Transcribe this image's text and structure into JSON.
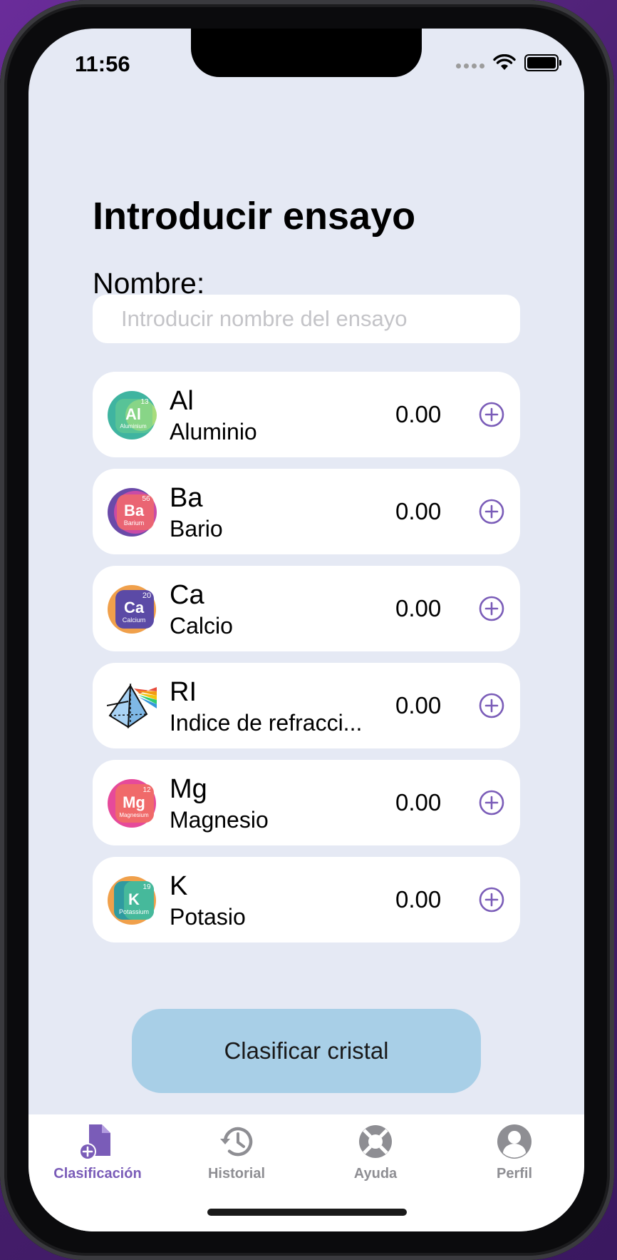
{
  "status_bar": {
    "time": "11:56"
  },
  "page": {
    "title": "Introducir ensayo",
    "name_label": "Nombre:",
    "name_input": {
      "value": "",
      "placeholder": "Introducir nombre del ensayo"
    }
  },
  "elements": [
    {
      "symbol": "Al",
      "name": "Aluminio",
      "value": "0.00",
      "icon": "aluminium-icon",
      "badge": {
        "symbol": "Al",
        "number": "13",
        "label": "Aluminium"
      }
    },
    {
      "symbol": "Ba",
      "name": "Bario",
      "value": "0.00",
      "icon": "barium-icon",
      "badge": {
        "symbol": "Ba",
        "number": "56",
        "label": "Barium"
      }
    },
    {
      "symbol": "Ca",
      "name": "Calcio",
      "value": "0.00",
      "icon": "calcium-icon",
      "badge": {
        "symbol": "Ca",
        "number": "20",
        "label": "Calcium"
      }
    },
    {
      "symbol": "RI",
      "name": "Indice de refracci...",
      "value": "0.00",
      "icon": "prism-icon"
    },
    {
      "symbol": "Mg",
      "name": "Magnesio",
      "value": "0.00",
      "icon": "magnesium-icon",
      "badge": {
        "symbol": "Mg",
        "number": "12",
        "label": "Magnesium"
      }
    },
    {
      "symbol": "K",
      "name": "Potasio",
      "value": "0.00",
      "icon": "potassium-icon",
      "badge": {
        "symbol": "K",
        "number": "19",
        "label": "Potassium"
      }
    }
  ],
  "classify_button": {
    "label": "Clasificar cristal"
  },
  "tabbar": {
    "items": [
      {
        "label": "Clasificación",
        "icon": "add-document-icon",
        "active": true
      },
      {
        "label": "Historial",
        "icon": "history-icon",
        "active": false
      },
      {
        "label": "Ayuda",
        "icon": "lifebuoy-icon",
        "active": false
      },
      {
        "label": "Perfil",
        "icon": "profile-icon",
        "active": false
      }
    ]
  },
  "colors": {
    "accent": "#7a5cb8",
    "inactive_tab": "#8e8e93",
    "background": "#e5e9f4",
    "button": "#a8cfe7",
    "aluminium": [
      "#3fb4a0",
      "#a8dc7c"
    ],
    "barium": [
      "#c94ba6",
      "#f06a6a"
    ],
    "calcium": [
      "#f0a04b",
      "#5b4aa6"
    ],
    "magnesium": [
      "#c94ba6",
      "#f06a6a"
    ],
    "potassium": [
      "#f0a04b",
      "#3fb4a0"
    ]
  }
}
